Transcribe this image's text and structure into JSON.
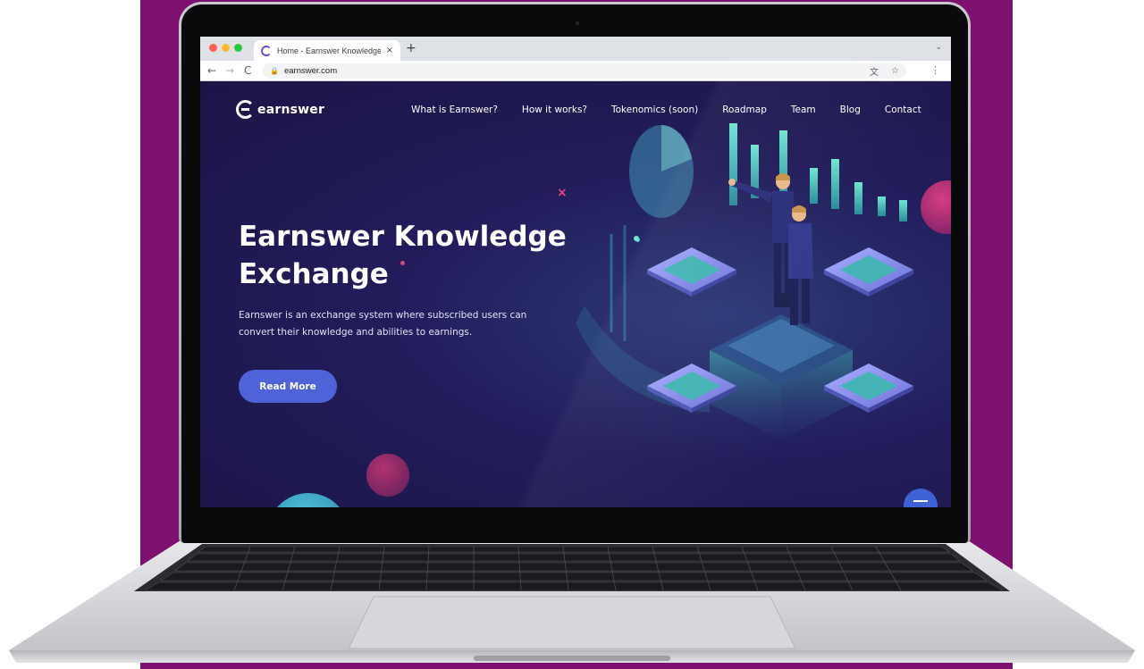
{
  "browser": {
    "tab_title": "Home - Earnswer Knowledge E",
    "tab_close": "×",
    "new_tab": "+",
    "tab_menu": "⌄",
    "url": "earnswer.com",
    "back": "←",
    "forward": "→",
    "reload": "C",
    "lock": "🔒",
    "translate_icon": "文",
    "bookmark_icon": "☆",
    "menu_icon": "⋮"
  },
  "site": {
    "logo_text": "earnswer",
    "nav": [
      "What is Earnswer?",
      "How it works?",
      "Tokenomics (soon)",
      "Roadmap",
      "Team",
      "Blog",
      "Contact"
    ],
    "hero_title": "Earnswer Knowledge Exchange",
    "hero_description": "Earnswer is an exchange system where subscribed users can convert their knowledge and abilities to earnings.",
    "cta_label": "Read More",
    "x_mark": "×"
  },
  "colors": {
    "background_purple": "#7e1170",
    "site_background": "#221c5b",
    "accent_blue": "#4e63d8",
    "teal": "#4fd6d2",
    "pink": "#e8477d"
  }
}
